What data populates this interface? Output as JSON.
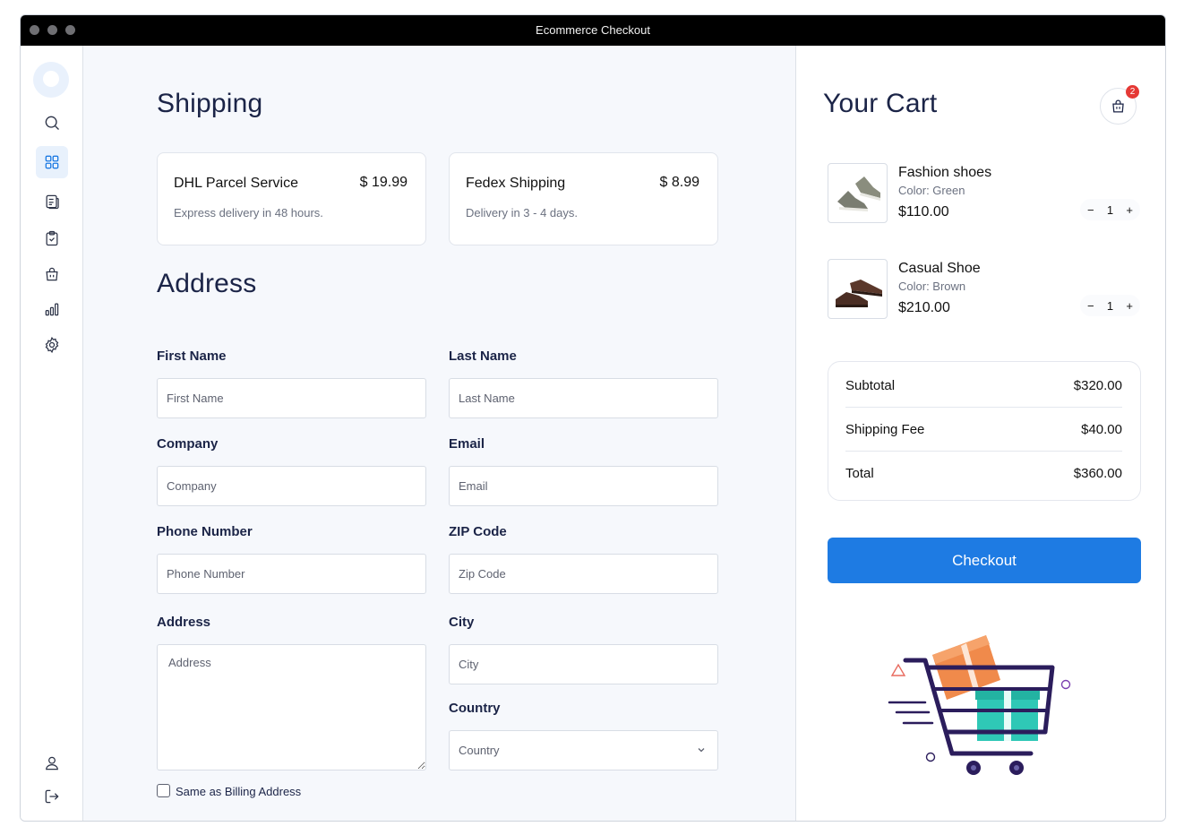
{
  "window": {
    "title": "Ecommerce Checkout"
  },
  "sidebar": {
    "items": [
      {
        "icon": "search-icon"
      },
      {
        "icon": "grid-icon",
        "active": true
      },
      {
        "icon": "document-icon"
      },
      {
        "icon": "clipboard-check-icon"
      },
      {
        "icon": "bag-icon"
      },
      {
        "icon": "bar-chart-icon"
      },
      {
        "icon": "gear-icon"
      }
    ],
    "bottom": [
      {
        "icon": "user-icon"
      },
      {
        "icon": "logout-icon"
      }
    ]
  },
  "shipping": {
    "title": "Shipping",
    "options": [
      {
        "name": "DHL Parcel Service",
        "price": "$ 19.99",
        "desc": "Express delivery in 48 hours."
      },
      {
        "name": "Fedex Shipping",
        "price": "$ 8.99",
        "desc": "Delivery in 3 - 4 days."
      }
    ]
  },
  "address": {
    "title": "Address",
    "first_name": {
      "label": "First Name",
      "placeholder": "First Name"
    },
    "last_name": {
      "label": "Last Name",
      "placeholder": "Last Name"
    },
    "company": {
      "label": "Company",
      "placeholder": "Company"
    },
    "email": {
      "label": "Email",
      "placeholder": "Email"
    },
    "phone": {
      "label": "Phone Number",
      "placeholder": "Phone Number"
    },
    "zip": {
      "label": "ZIP Code",
      "placeholder": "Zip Code"
    },
    "address": {
      "label": "Address",
      "placeholder": "Address"
    },
    "city": {
      "label": "City",
      "placeholder": "City"
    },
    "country": {
      "label": "Country",
      "value": "Country"
    },
    "same_billing": "Same as Billing Address"
  },
  "cart": {
    "title": "Your Cart",
    "badge_count": "2",
    "items": [
      {
        "name": "Fashion shoes",
        "color": "Color: Green",
        "price": "$110.00",
        "qty": "1"
      },
      {
        "name": "Casual Shoe",
        "color": "Color: Brown",
        "price": "$210.00",
        "qty": "1"
      }
    ],
    "summary": {
      "subtotal_label": "Subtotal",
      "subtotal": "$320.00",
      "shipping_label": "Shipping Fee",
      "shipping": "$40.00",
      "total_label": "Total",
      "total": "$360.00"
    },
    "checkout_label": "Checkout",
    "qty_minus": "−",
    "qty_plus": "+"
  },
  "colors": {
    "accent": "#1e7be3",
    "badge": "#e53935",
    "heading": "#1b2447"
  }
}
